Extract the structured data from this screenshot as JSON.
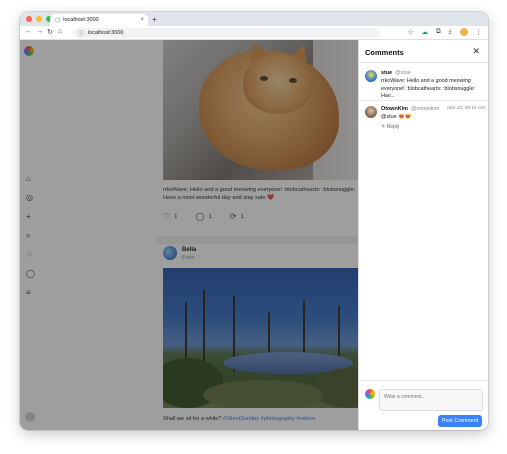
{
  "browser": {
    "tab_title": "localhost:3000",
    "tab_close": "×",
    "new_tab": "+",
    "url": "localhost:3000",
    "nav": {
      "back": "←",
      "forward": "→",
      "reload": "↻",
      "home": "⌂"
    },
    "tools": {
      "star": "☆",
      "extensions": "⧉",
      "download": "⤓",
      "menu": "⋮"
    },
    "lights": [
      "#ff5f57",
      "#febc2e",
      "#28c840"
    ]
  },
  "feed": {
    "post1": {
      "text": "rrkoWave: Hello and a good meowing everyone! :blobcathearts: :blobsnuggle: Have a most wonderful day and stay safe ❤️",
      "likes": "1",
      "comments": "1",
      "boosts": "1"
    },
    "post2": {
      "author": "Bella",
      "time": "8 min",
      "caption_prefix": "Shall we sit for a while? ",
      "caption_tags": "#SilentSunday #photography #nature"
    }
  },
  "comments": {
    "title": "Comments",
    "close": "✕",
    "original": {
      "name": "stue",
      "handle": "@stue",
      "text": "rrkoWave: Hello and a good meowing everyone! :blobcathearts: :blobsnuggle: Hav..."
    },
    "reply": {
      "name": "OtownKim",
      "handle": "@otownkim",
      "date": "Mar 23, 09:15 AM",
      "text": "@stue 😻😻",
      "reply_label": "↰ Reply"
    },
    "composer_placeholder": "Write a comment...",
    "post_button": "Post Comment"
  }
}
